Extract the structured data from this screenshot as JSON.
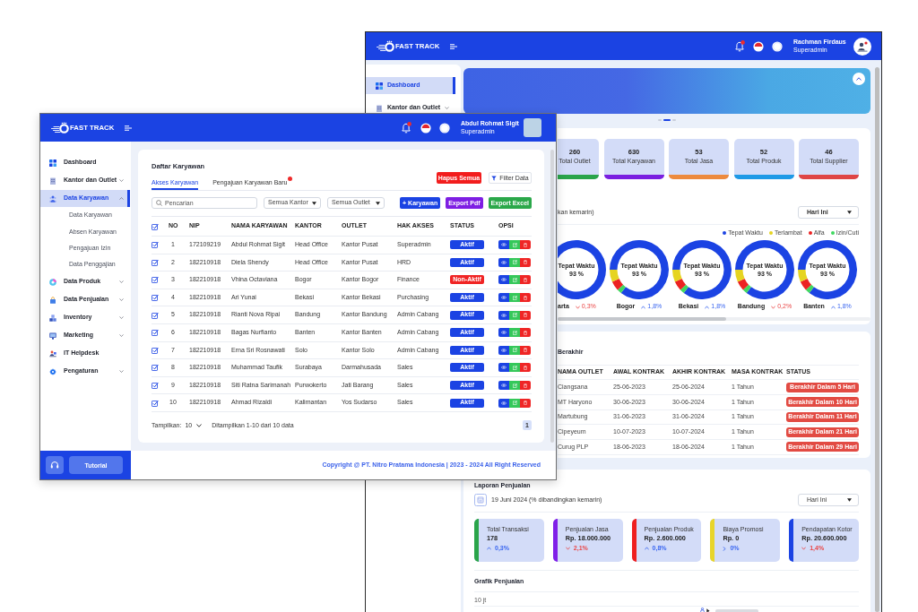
{
  "back_window": {
    "header": {
      "brand": "FAST TRACK",
      "user_name": "Rachman Firdaus",
      "user_role": "Superadmin"
    },
    "sidebar": {
      "items": [
        {
          "kind": "link",
          "label": "Dashboard",
          "selected": true
        },
        {
          "kind": "group",
          "label": "Kantor dan Outlet",
          "selected": false,
          "expanded": false
        }
      ]
    },
    "carousel": [
      {
        "selected": false
      },
      {
        "selected": true
      },
      {
        "selected": false
      }
    ],
    "stat_cards": [
      {
        "value": "260",
        "label": "Total Outlet",
        "color": "#2aa44a"
      },
      {
        "value": "630",
        "label": "Total Karyawan",
        "color": "#7a1fe0"
      },
      {
        "value": "53",
        "label": "Total Jasa",
        "color": "#ed8a3d"
      },
      {
        "value": "52",
        "label": "Total Produk",
        "color": "#1f9ae6"
      },
      {
        "value": "46",
        "label": "Total Supplier",
        "color": "#df4545"
      }
    ],
    "attendance": {
      "caption": "kan kemarin)",
      "period": "Hari Ini",
      "legend": [
        {
          "label": "Tepat Waktu",
          "color": "#1b43e3"
        },
        {
          "label": "Terlambat",
          "color": "#e6d421"
        },
        {
          "label": "Alfa",
          "color": "#ec2222"
        },
        {
          "label": "Izin/Cuti",
          "color": "#40d860"
        }
      ],
      "locations": [
        {
          "name": "arta",
          "center_label": "Tepat Waktu",
          "center_value": "93 %",
          "kind": "down",
          "change": "0,3%"
        },
        {
          "name": "Bogor",
          "center_label": "Tepat Waktu",
          "center_value": "93 %",
          "kind": "up",
          "change": "1,8%"
        },
        {
          "name": "Bekasi",
          "center_label": "Tepat Waktu",
          "center_value": "93 %",
          "kind": "up",
          "change": "1,8%"
        },
        {
          "name": "Bandung",
          "center_label": "Tepat Waktu",
          "center_value": "93 %",
          "kind": "down",
          "change": "0,2%"
        },
        {
          "name": "Banten",
          "center_label": "Tepat Waktu",
          "center_value": "93 %",
          "kind": "up",
          "change": "1,8%"
        }
      ]
    },
    "contracts": {
      "title": "Berakhir",
      "columns": [
        "NAMA OUTLET",
        "AWAL KONTRAK",
        "AKHIR KONTRAK",
        "MASA KONTRAK",
        "STATUS"
      ],
      "rows": [
        {
          "outlet": "Ciangsana",
          "start": "25-06-2023",
          "end": "25-06-2024",
          "duration": "1 Tahun",
          "status": "Berakhir Dalam 5 Hari"
        },
        {
          "outlet": "MT Haryono",
          "start": "30-06-2023",
          "end": "30-06-2024",
          "duration": "1 Tahun",
          "status": "Berakhir Dalam 10 Hari"
        },
        {
          "outlet": "Martubung",
          "start": "31-06-2023",
          "end": "31-06-2024",
          "duration": "1 Tahun",
          "status": "Berakhir Dalam 11 Hari"
        },
        {
          "outlet": "Cipeyeum",
          "start": "10-07-2023",
          "end": "10-07-2024",
          "duration": "1 Tahun",
          "status": "Berakhir Dalam 21 Hari"
        },
        {
          "outlet": "Curug PLP",
          "start": "18-06-2023",
          "end": "18-06-2024",
          "duration": "1 Tahun",
          "status": "Berakhir Dalam 29 Hari"
        }
      ]
    },
    "sales_report": {
      "title": "Laporan Penjualan",
      "caption": "19 Juni 2024 (% dibandingkan kemarin)",
      "period": "Hari Ini",
      "cards": [
        {
          "label": "Total Transaksi",
          "value": "178",
          "kind": "up",
          "change": "0,3%",
          "color": "#2aa44a"
        },
        {
          "label": "Penjualan Jasa",
          "value": "Rp. 18.000.000",
          "kind": "down",
          "change": "2,1%",
          "color": "#8020e8"
        },
        {
          "label": "Penjualan Produk",
          "value": "Rp. 2.600.000",
          "kind": "up",
          "change": "0,8%",
          "color": "#ef1f1f"
        },
        {
          "label": "Biaya Promosi",
          "value": "Rp. 0",
          "kind": "flat",
          "change": "0%",
          "color": "#e8d52a"
        },
        {
          "label": "Pendapatan Kotor",
          "value": "Rp. 20.600.000",
          "kind": "down",
          "change": "1,4%",
          "color": "#1b43e3"
        }
      ]
    },
    "sales_chart": {
      "title": "Grafik Penjualan",
      "y_tick": "10 jt"
    }
  },
  "front_window": {
    "header": {
      "brand": "FAST TRACK",
      "user_name": "Abdul Rohmat Sigit",
      "user_role": "Superadmin"
    },
    "sidebar": {
      "items": [
        {
          "kind": "link",
          "label": "Dashboard",
          "selected": false
        },
        {
          "kind": "group",
          "label": "Kantor dan Outlet",
          "selected": false,
          "expanded": false
        },
        {
          "kind": "group",
          "label": "Data Karyawan",
          "selected": true,
          "expanded": true,
          "children": [
            {
              "label": "Data Karyawan",
              "selected": false
            },
            {
              "label": "Absen Karyawan",
              "selected": false
            },
            {
              "label": "Pengajuan Izin",
              "selected": false
            },
            {
              "label": "Data Penggajian",
              "selected": false
            }
          ]
        },
        {
          "kind": "group",
          "label": "Data Produk",
          "selected": false,
          "expanded": false
        },
        {
          "kind": "group",
          "label": "Data Penjualan",
          "selected": false,
          "expanded": false
        },
        {
          "kind": "group",
          "label": "Inventory",
          "selected": false,
          "expanded": false
        },
        {
          "kind": "group",
          "label": "Marketing",
          "selected": false,
          "expanded": false
        },
        {
          "kind": "link",
          "label": "IT Helpdesk",
          "selected": false
        },
        {
          "kind": "group",
          "label": "Pengaturan",
          "selected": false,
          "expanded": false
        }
      ],
      "tutorial_button": "Tutorial"
    },
    "page_title": "Daftar Karyawan",
    "tabs": [
      {
        "label": "Akses Karyawan",
        "selected": true,
        "notification": false
      },
      {
        "label": "Pengajuan Karyawan Baru",
        "selected": false,
        "notification": true
      }
    ],
    "header_buttons": [
      {
        "kind": "danger",
        "label": "Hapus Semua"
      },
      {
        "kind": "filter",
        "label": "Filter Data"
      }
    ],
    "toolbar": {
      "search": {
        "placeholder": "Pencarian"
      },
      "selects": [
        {
          "value": "Semua Kantor"
        },
        {
          "value": "Semua Outlet"
        }
      ],
      "buttons": [
        {
          "label": "+ Karyawan",
          "color": "#1b43e3"
        },
        {
          "label": "Export Pdf",
          "color": "#7e1fe3"
        },
        {
          "label": "Export Excel",
          "color": "#2ba84a"
        }
      ]
    },
    "table": {
      "all_checked": true,
      "columns": [
        "NO",
        "NIP",
        "NAMA KARYAWAN",
        "KANTOR",
        "OUTLET",
        "HAK AKSES",
        "STATUS",
        "OPSI"
      ],
      "rows": [
        {
          "no": "1",
          "nip": "172109219",
          "name": "Abdul Rohmat Sigit",
          "office": "Head Office",
          "outlet": "Kantor Pusat",
          "role": "Superadmin",
          "status": "Aktif",
          "active": true,
          "checked": true
        },
        {
          "no": "2",
          "nip": "182210918",
          "name": "Diela Shendy",
          "office": "Head Office",
          "outlet": "Kantor Pusat",
          "role": "HRD",
          "status": "Aktif",
          "active": true,
          "checked": true
        },
        {
          "no": "3",
          "nip": "182210918",
          "name": "Vhina Octaviana",
          "office": "Bogor",
          "outlet": "Kantor Bogor",
          "role": "Finance",
          "status": "Non-Aktif",
          "active": false,
          "checked": true
        },
        {
          "no": "4",
          "nip": "182210918",
          "name": "Ari Yunai",
          "office": "Bekasi",
          "outlet": "Kantor Bekasi",
          "role": "Purchasing",
          "status": "Aktif",
          "active": true,
          "checked": true
        },
        {
          "no": "5",
          "nip": "182210918",
          "name": "Rianti Nova Ripai",
          "office": "Bandung",
          "outlet": "Kantor Bandung",
          "role": "Admin Cabang",
          "status": "Aktif",
          "active": true,
          "checked": true
        },
        {
          "no": "6",
          "nip": "182210918",
          "name": "Bagas Nurfianto",
          "office": "Banten",
          "outlet": "Kantor Banten",
          "role": "Admin Cabang",
          "status": "Aktif",
          "active": true,
          "checked": true
        },
        {
          "no": "7",
          "nip": "182210918",
          "name": "Erna Sri Rosnawati",
          "office": "Solo",
          "outlet": "Kantor Solo",
          "role": "Admin Cabang",
          "status": "Aktif",
          "active": true,
          "checked": true
        },
        {
          "no": "8",
          "nip": "182210918",
          "name": "Muhammad Taufik",
          "office": "Surabaya",
          "outlet": "Darmahusada",
          "role": "Sales",
          "status": "Aktif",
          "active": true,
          "checked": true
        },
        {
          "no": "9",
          "nip": "182210918",
          "name": "Siti Ratna Sarimanah",
          "office": "Purwokerto",
          "outlet": "Jati Barang",
          "role": "Sales",
          "status": "Aktif",
          "active": true,
          "checked": true
        },
        {
          "no": "10",
          "nip": "182210918",
          "name": "Ahmad Rizaldi",
          "office": "Kalimantan",
          "outlet": "Yos Sudarso",
          "role": "Sales",
          "status": "Aktif",
          "active": true,
          "checked": true
        }
      ]
    },
    "pager": {
      "label": "Tampilkan:",
      "page_size": "10",
      "summary": "Ditampilkan 1-10 dari 10 data",
      "pages": [
        {
          "label": "1",
          "selected": true
        }
      ]
    },
    "footer": "Copyright @ PT. Nitro Pratama Indonesia | 2023 - 2024 All Right Reserved"
  }
}
